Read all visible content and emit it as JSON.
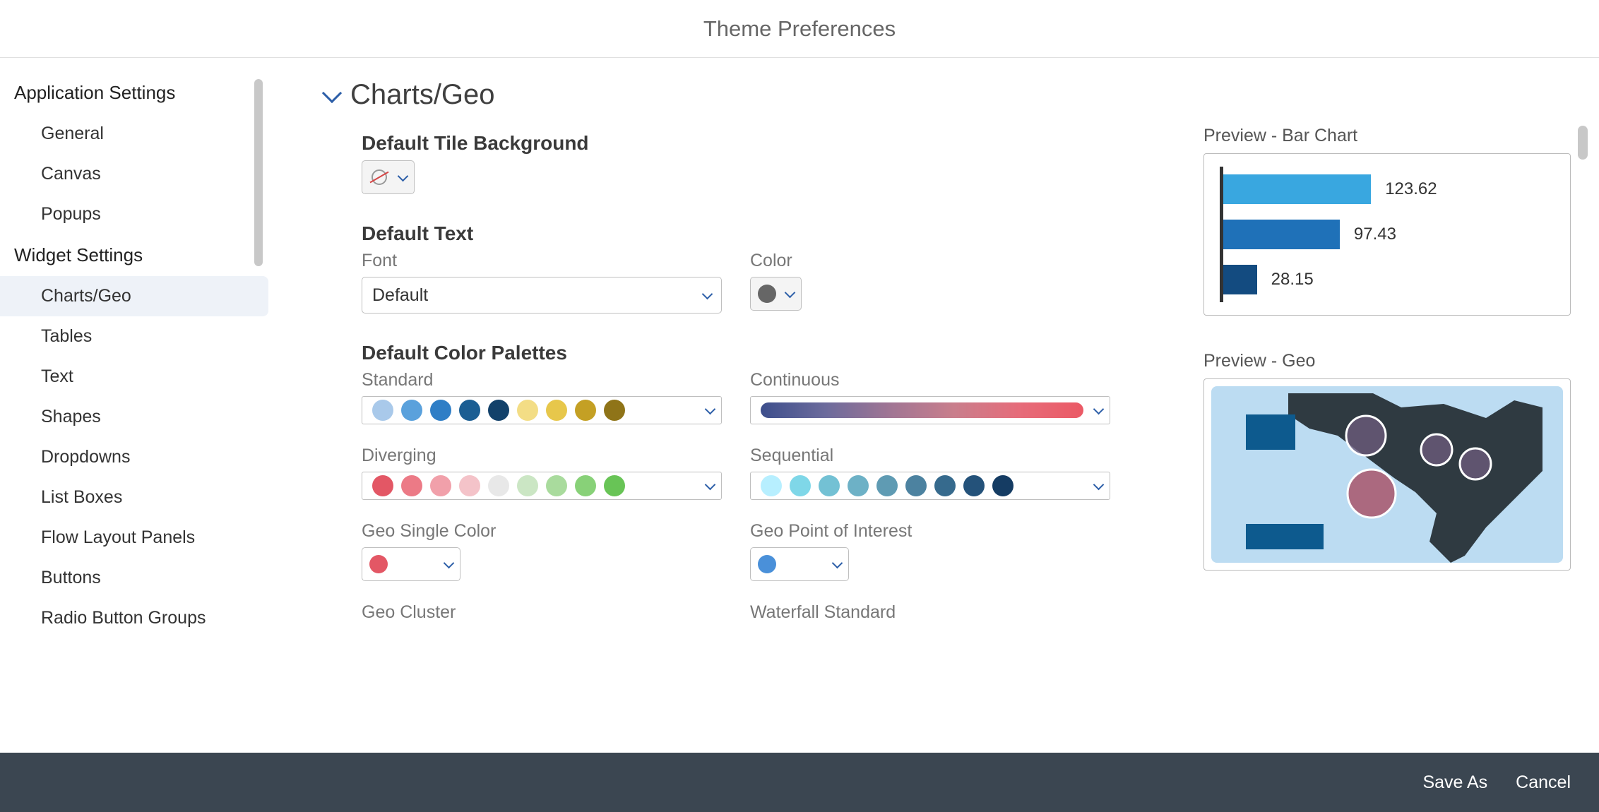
{
  "header": {
    "title": "Theme Preferences"
  },
  "sidebar": {
    "groups": [
      {
        "heading": "Application Settings",
        "items": [
          {
            "label": "General"
          },
          {
            "label": "Canvas"
          },
          {
            "label": "Popups"
          }
        ]
      },
      {
        "heading": "Widget Settings",
        "items": [
          {
            "label": "Charts/Geo",
            "active": true
          },
          {
            "label": "Tables"
          },
          {
            "label": "Text"
          },
          {
            "label": "Shapes"
          },
          {
            "label": "Dropdowns"
          },
          {
            "label": "List Boxes"
          },
          {
            "label": "Flow Layout Panels"
          },
          {
            "label": "Buttons"
          },
          {
            "label": "Radio Button Groups"
          }
        ]
      }
    ]
  },
  "section": {
    "title": "Charts/Geo"
  },
  "tileBg": {
    "title": "Default Tile Background"
  },
  "defaultText": {
    "title": "Default Text",
    "fontLabel": "Font",
    "fontValue": "Default",
    "colorLabel": "Color",
    "colorValue": "#666666"
  },
  "palettes": {
    "title": "Default Color Palettes",
    "standardLabel": "Standard",
    "standard": [
      "#a9c9ea",
      "#5aa1dc",
      "#2f7ec6",
      "#1b5e93",
      "#12416a",
      "#f3dd85",
      "#e7c74b",
      "#c4a024",
      "#8f7418"
    ],
    "continuousLabel": "Continuous",
    "continuousGradient": "linear-gradient(90deg,#3d4e8c,#6c6b9c,#a07594,#c97e8c,#e66c7a,#eb5965)",
    "divergingLabel": "Diverging",
    "diverging": [
      "#e35765",
      "#ec7a86",
      "#f1a0aa",
      "#f4c3c9",
      "#e8e8e8",
      "#cbe6c4",
      "#a9db9d",
      "#88d178",
      "#68c456"
    ],
    "sequentialLabel": "Sequential",
    "sequential": [
      "#b7efff",
      "#7fd7e8",
      "#73c1d4",
      "#6db1c6",
      "#5f9bb3",
      "#4c82a0",
      "#366a8d",
      "#24527a",
      "#153c63"
    ],
    "geoSingleLabel": "Geo Single Color",
    "geoSingle": "#e35765",
    "geoPoiLabel": "Geo Point of Interest",
    "geoPoi": "#4a90d9",
    "geoClusterLabel": "Geo Cluster",
    "waterfallLabel": "Waterfall Standard"
  },
  "preview": {
    "barTitle": "Preview - Bar Chart",
    "geoTitle": "Preview - Geo"
  },
  "chart_data": {
    "type": "bar",
    "orientation": "horizontal",
    "title": "Preview - Bar Chart",
    "categories": [
      "",
      "",
      ""
    ],
    "values": [
      123.62,
      97.43,
      28.15
    ],
    "colors": [
      "#39a7e0",
      "#1f71b8",
      "#134b80"
    ],
    "xlim": [
      0,
      130
    ]
  },
  "footer": {
    "saveAs": "Save As",
    "cancel": "Cancel"
  }
}
